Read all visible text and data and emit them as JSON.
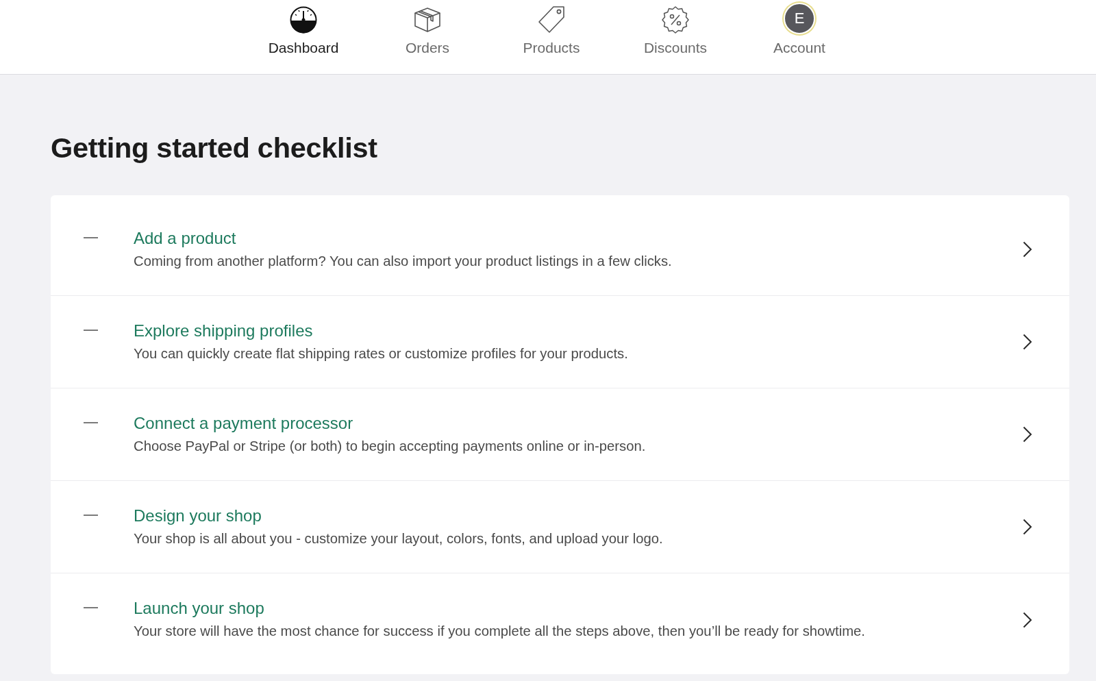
{
  "nav": {
    "items": [
      {
        "label": "Dashboard",
        "selected": true,
        "kind": "icon"
      },
      {
        "label": "Orders",
        "selected": false,
        "kind": "icon"
      },
      {
        "label": "Products",
        "selected": false,
        "kind": "icon"
      },
      {
        "label": "Discounts",
        "selected": false,
        "kind": "icon"
      },
      {
        "label": "Account",
        "selected": false,
        "kind": "avatar",
        "initial": "E"
      }
    ]
  },
  "page_title": "Getting started checklist",
  "checklist": [
    {
      "title": "Add a product",
      "description": "Coming from another platform? You can also import your product listings in a few clicks.",
      "completed": false
    },
    {
      "title": "Explore shipping profiles",
      "description": "You can quickly create flat shipping rates or customize profiles for your products.",
      "completed": false
    },
    {
      "title": "Connect a payment processor",
      "description": "Choose PayPal or Stripe (or both) to begin accepting payments online or in-person.",
      "completed": false
    },
    {
      "title": "Design your shop",
      "description": "Your shop is all about you - customize your layout, colors, fonts, and upload your logo.",
      "completed": false
    },
    {
      "title": "Launch your shop",
      "description": "Your store will have the most chance for success if you complete all the steps above, then you’ll be ready for showtime.",
      "completed": false
    }
  ]
}
